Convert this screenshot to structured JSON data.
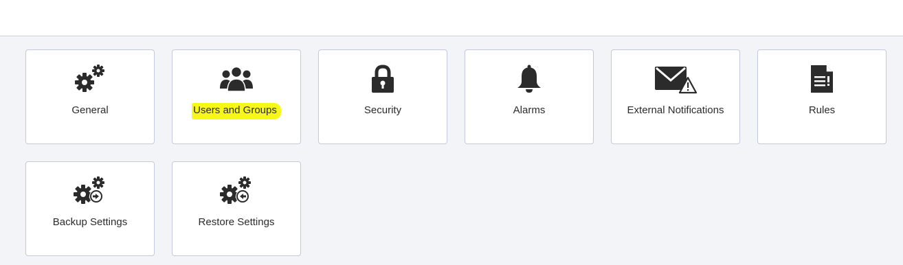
{
  "tiles": [
    {
      "label": "General",
      "icon": "gears-icon"
    },
    {
      "label": "Users and Groups",
      "icon": "users-icon",
      "highlighted": true
    },
    {
      "label": "Security",
      "icon": "lock-icon"
    },
    {
      "label": "Alarms",
      "icon": "bell-icon"
    },
    {
      "label": "External Notifications",
      "icon": "envelope-warning-icon"
    },
    {
      "label": "Rules",
      "icon": "document-icon"
    },
    {
      "label": "Backup Settings",
      "icon": "gears-export-icon"
    },
    {
      "label": "Restore Settings",
      "icon": "gears-import-icon"
    }
  ],
  "colors": {
    "icon": "#2b2b2b",
    "tile_border": "#c3c8da",
    "background": "#f3f4f8",
    "highlight": "#f7f71a"
  }
}
